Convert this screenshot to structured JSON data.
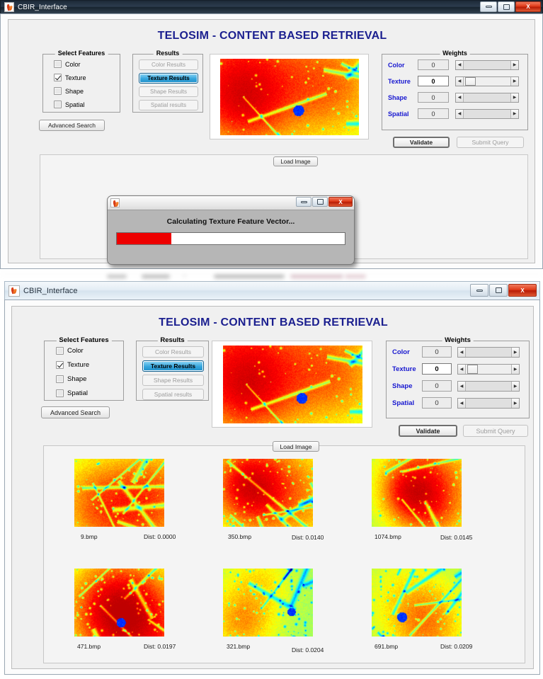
{
  "app_name": "CBIR_Interface",
  "app_title": "TELOSIM - CONTENT BASED RETRIEVAL",
  "colors": {
    "title_blue": "#1b1f8f",
    "label_blue": "#1717d0",
    "selected_button": "#36a6dd",
    "progress_fill": "#ee0000",
    "close_button": "#e03b19"
  },
  "window_controls": {
    "minimize": "minimize",
    "maximize": "maximize",
    "close": "X"
  },
  "select_features": {
    "legend": "Select Features",
    "items": [
      {
        "label": "Color",
        "checked": false
      },
      {
        "label": "Texture",
        "checked": true
      },
      {
        "label": "Shape",
        "checked": false
      },
      {
        "label": "Spatial",
        "checked": false
      }
    ]
  },
  "results_group": {
    "legend": "Results",
    "buttons": [
      {
        "label": "Color Results",
        "state": "disabled"
      },
      {
        "label": "Texture Results",
        "state": "selected"
      },
      {
        "label": "Shape Results",
        "state": "disabled"
      },
      {
        "label": "Spatial results",
        "state": "disabled"
      }
    ]
  },
  "advanced_search_label": "Advanced Search",
  "load_image_label": "Load Image",
  "weights": {
    "legend": "Weights",
    "rows": [
      {
        "label": "Color",
        "value": "0",
        "active": false,
        "thumb_pct": 0
      },
      {
        "label": "Texture",
        "value": "0",
        "active": true,
        "thumb_pct": 8
      },
      {
        "label": "Shape",
        "value": "0",
        "active": false,
        "thumb_pct": 0
      },
      {
        "label": "Spatial",
        "value": "0",
        "active": false,
        "thumb_pct": 0
      }
    ],
    "validate_label": "Validate",
    "submit_label": "Submit Query"
  },
  "progress_dialog": {
    "message": "Calculating Texture Feature Vector...",
    "percent": 24
  },
  "results_grid": [
    {
      "name": "9.bmp",
      "dist": "Dist: 0.0000"
    },
    {
      "name": "350.bmp",
      "dist": "Dist: 0.0140"
    },
    {
      "name": "1074.bmp",
      "dist": "Dist: 0.0145"
    },
    {
      "name": "471.bmp",
      "dist": "Dist: 0.0197"
    },
    {
      "name": "321.bmp",
      "dist": "Dist: 0.0204"
    },
    {
      "name": "691.bmp",
      "dist": "Dist: 0.0209"
    }
  ]
}
